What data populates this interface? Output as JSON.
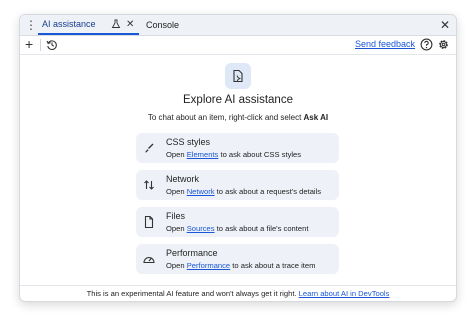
{
  "tabs": {
    "ai_assistance": "AI assistance",
    "console": "Console"
  },
  "toolbar": {
    "send_feedback": "Send feedback"
  },
  "hero": {
    "title": "Explore AI assistance",
    "subtitle_prefix": "To chat about an item, right-click and select ",
    "subtitle_bold": "Ask AI"
  },
  "cards": [
    {
      "title": "CSS styles",
      "pre": "Open ",
      "link": "Elements",
      "post": " to ask about CSS styles",
      "icon": "paintbrush-icon"
    },
    {
      "title": "Network",
      "pre": "Open ",
      "link": "Network",
      "post": " to ask about a request's details",
      "icon": "network-arrows-icon"
    },
    {
      "title": "Files",
      "pre": "Open ",
      "link": "Sources",
      "post": " to ask about a file's content",
      "icon": "file-icon"
    },
    {
      "title": "Performance",
      "pre": "Open ",
      "link": "Performance",
      "post": " to ask about a trace item",
      "icon": "speedometer-icon"
    }
  ],
  "footer": {
    "text": "This is an experimental AI feature and won't always get it right. ",
    "link": "Learn about AI in DevTools"
  },
  "colors": {
    "accent": "#1a57d6",
    "card_bg": "#eef2f8",
    "tabbar_bg": "#eef1f6"
  }
}
